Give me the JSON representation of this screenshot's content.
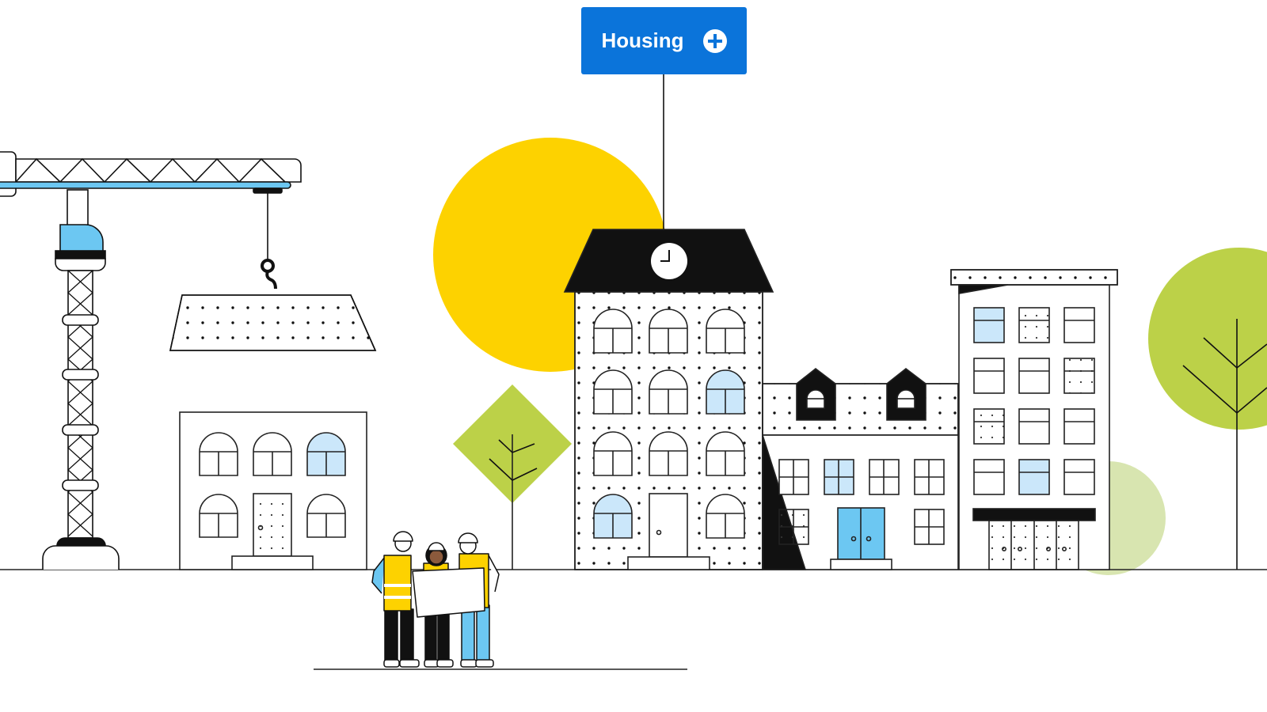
{
  "category_button": {
    "label": "Housing",
    "icon": "plus-circle-icon"
  },
  "colors": {
    "button_blue": "#0B74DA",
    "sun_yellow": "#FDD200",
    "tree_green": "#BCD148",
    "tree_light_green": "#D8E5B0",
    "sky_blue": "#6CC7F2",
    "window_light_blue": "#CBE7FA",
    "ink": "#111111"
  },
  "illustration": {
    "description": "Line-art city scene with a construction crane, houses, trees, sun, and three construction workers reviewing a blueprint",
    "elements": [
      "crane",
      "hanging-slab",
      "small-house",
      "sun",
      "diamond-tree",
      "clock-tower-building",
      "dormer-house",
      "apartment-block",
      "round-tree",
      "workers-group"
    ]
  }
}
